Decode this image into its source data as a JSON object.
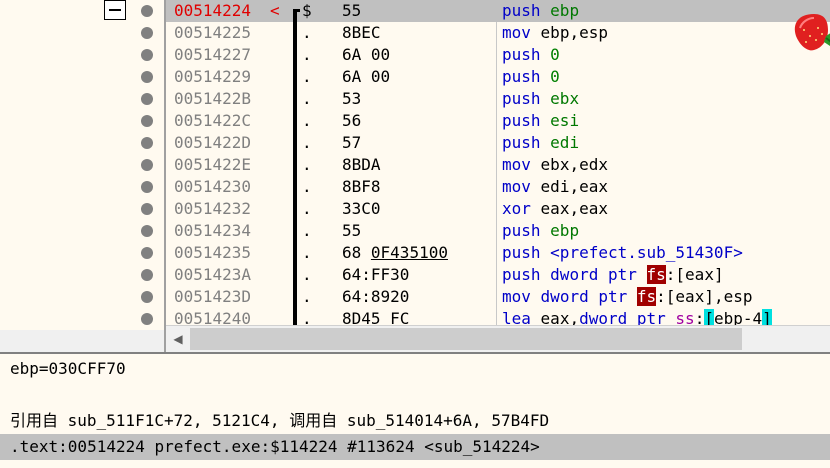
{
  "rows": [
    {
      "addr": "00514224",
      "arrow": "<",
      "flag": "$",
      "hex": "55",
      "mnemonic": "push",
      "ops": [
        {
          "t": "ebp",
          "c": "reg"
        }
      ]
    },
    {
      "addr": "00514225",
      "flag": ".",
      "hex": "8BEC",
      "mnemonic": "mov",
      "ops": [
        {
          "t": "ebp,esp",
          "c": ""
        }
      ]
    },
    {
      "addr": "00514227",
      "flag": ".",
      "hex": "6A 00",
      "mnemonic": "push",
      "ops": [
        {
          "t": "0",
          "c": "num"
        }
      ]
    },
    {
      "addr": "00514229",
      "flag": ".",
      "hex": "6A 00",
      "mnemonic": "push",
      "ops": [
        {
          "t": "0",
          "c": "num"
        }
      ]
    },
    {
      "addr": "0051422B",
      "flag": ".",
      "hex": "53",
      "mnemonic": "push",
      "ops": [
        {
          "t": "ebx",
          "c": "reg"
        }
      ]
    },
    {
      "addr": "0051422C",
      "flag": ".",
      "hex": "56",
      "mnemonic": "push",
      "ops": [
        {
          "t": "esi",
          "c": "reg"
        }
      ]
    },
    {
      "addr": "0051422D",
      "flag": ".",
      "hex": "57",
      "mnemonic": "push",
      "ops": [
        {
          "t": "edi",
          "c": "reg"
        }
      ]
    },
    {
      "addr": "0051422E",
      "flag": ".",
      "hex": "8BDA",
      "mnemonic": "mov",
      "ops": [
        {
          "t": "ebx,edx",
          "c": ""
        }
      ]
    },
    {
      "addr": "00514230",
      "flag": ".",
      "hex": "8BF8",
      "mnemonic": "mov",
      "ops": [
        {
          "t": "edi,eax",
          "c": ""
        }
      ]
    },
    {
      "addr": "00514232",
      "flag": ".",
      "hex": "33C0",
      "mnemonic": "xor",
      "ops": [
        {
          "t": "eax,eax",
          "c": ""
        }
      ]
    },
    {
      "addr": "00514234",
      "flag": ".",
      "hex": "55",
      "mnemonic": "push",
      "ops": [
        {
          "t": "ebp",
          "c": "reg"
        }
      ]
    },
    {
      "addr": "00514235",
      "flag": ".",
      "hex_pre": "68 ",
      "hex_u": "0F435100",
      "mnemonic": "push",
      "ops": [
        {
          "t": "<prefect.sub_51430F>",
          "c": "sym"
        }
      ]
    },
    {
      "addr": "0051423A",
      "flag": ".",
      "hex": "64:FF30",
      "mnemonic": "push",
      "ops": [
        {
          "t": "dword ptr",
          "c": "kw"
        },
        {
          "t": " ",
          "c": ""
        },
        {
          "t": "fs",
          "c": "seg"
        },
        {
          "t": ":[",
          "c": ""
        },
        {
          "t": "eax",
          "c": ""
        },
        {
          "t": "]",
          "c": ""
        }
      ]
    },
    {
      "addr": "0051423D",
      "flag": ".",
      "hex": "64:8920",
      "mnemonic": "mov",
      "ops": [
        {
          "t": "dword ptr",
          "c": "kw"
        },
        {
          "t": " ",
          "c": ""
        },
        {
          "t": "fs",
          "c": "seg"
        },
        {
          "t": ":[",
          "c": ""
        },
        {
          "t": "eax",
          "c": ""
        },
        {
          "t": "],esp",
          "c": ""
        }
      ]
    },
    {
      "addr": "00514240",
      "flag": ".",
      "hex": "8D45 FC",
      "mnemonic": "lea",
      "ops": [
        {
          "t": "eax,",
          "c": ""
        },
        {
          "t": "dword ptr",
          "c": "kw"
        },
        {
          "t": " ",
          "c": ""
        },
        {
          "t": "ss",
          "c": "seg2"
        },
        {
          "t": ":",
          "c": ""
        },
        {
          "t": "[",
          "c": "brk"
        },
        {
          "t": "ebp-4",
          "c": ""
        },
        {
          "t": "]",
          "c": "brk"
        }
      ]
    }
  ],
  "info": {
    "line1": "ebp=030CFF70",
    "line2": "",
    "line3": "引用自 sub_511F1C+72, 5121C4, 调用自 sub_514014+6A, 57B4FD"
  },
  "status": {
    "text": ".text:00514224 prefect.exe:$114224 #113624 <sub_514224>"
  },
  "scroll": {
    "left_arrow": "◀"
  }
}
